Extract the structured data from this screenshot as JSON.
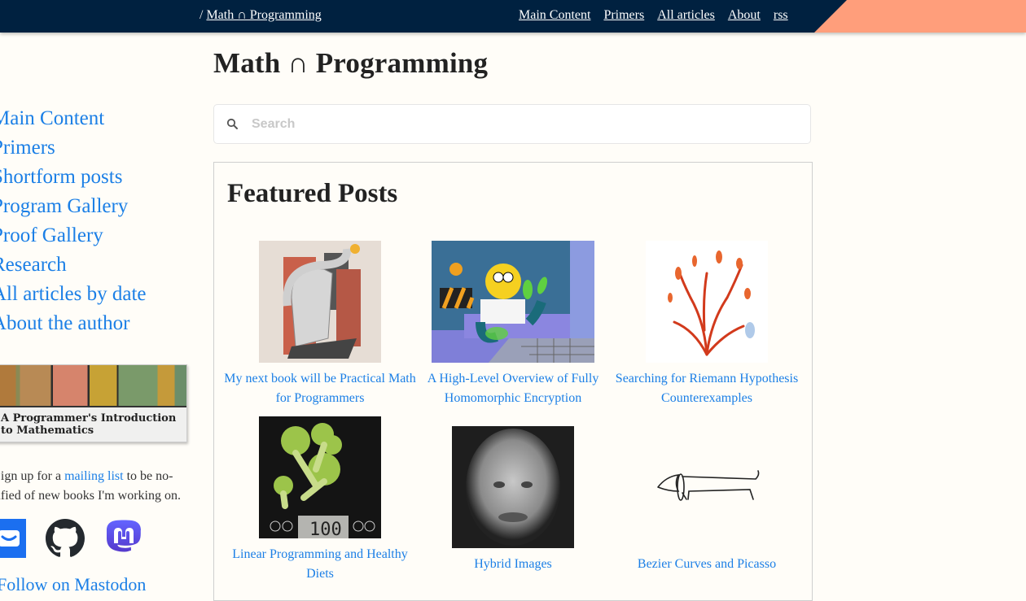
{
  "topbar": {
    "breadcrumb_sep": "/",
    "breadcrumb_link": "Math ∩ Programming",
    "nav": [
      {
        "label": "Main Content"
      },
      {
        "label": "Primers"
      },
      {
        "label": "All articles"
      },
      {
        "label": "About"
      },
      {
        "label": "rss"
      }
    ]
  },
  "sidebar": {
    "links": [
      {
        "label": "Main Content"
      },
      {
        "label": "Primers"
      },
      {
        "label": "Shortform posts"
      },
      {
        "label": "Program Gallery"
      },
      {
        "label": "Proof Gallery"
      },
      {
        "label": "Research"
      },
      {
        "label": "All articles by date"
      },
      {
        "label": "About the author"
      }
    ],
    "book": {
      "title_line1": "A Programmer's Introduction",
      "title_line2": "to Mathematics"
    },
    "signup": {
      "prefix": "Sign up for a ",
      "link": "mailing list",
      "suffix": " to be no-",
      "line2": "tified of new books I'm working on."
    },
    "social": [
      {
        "icon": "mail-icon"
      },
      {
        "icon": "github-icon"
      },
      {
        "icon": "mastodon-icon"
      }
    ],
    "bottom_link": "Follow on Mastodon"
  },
  "main": {
    "title": "Math ∩ Programming",
    "search": {
      "placeholder": "Search",
      "value": ""
    },
    "featured": {
      "heading": "Featured Posts",
      "posts": [
        {
          "title": "My next book will be Practical Math for Programmers",
          "image": "abstract-cubist-painting"
        },
        {
          "title": "A High-Level Overview of Fully Homomorphic Encryption",
          "image": "homer-simpson-glovebox"
        },
        {
          "title": "Searching for Riemann Hypothesis Counterexamples",
          "image": "red-fractal-plant"
        },
        {
          "title": "Linear Programming and Healthy Diets",
          "image": "broccoli-on-scale"
        },
        {
          "title": "Hybrid Images",
          "image": "einstein-monroe-hybrid"
        },
        {
          "title": "Bezier Curves and Picasso",
          "image": "picasso-dog-line-drawing"
        }
      ]
    }
  },
  "colors": {
    "topbar_bg": "#002140",
    "topbar_accent": "#ff9e7b",
    "link": "#1b7fe6",
    "page_bg": "#fffdf8"
  }
}
